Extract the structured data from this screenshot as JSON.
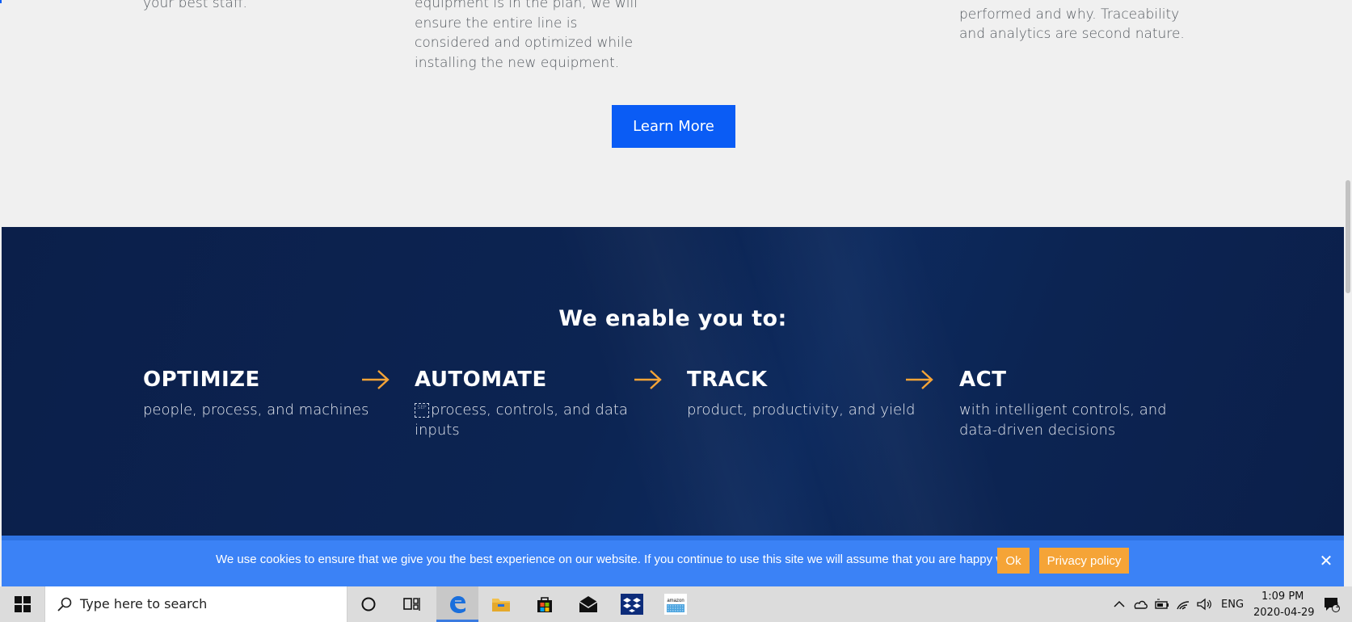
{
  "light": {
    "col1_tail": "your best staff.",
    "col2_lines": [
      "equipment is in the plan, we will",
      "ensure the entire line is",
      "considered and optimized while",
      "installing the new equipment."
    ],
    "col4_lines": [
      "performed and why. Traceability",
      "and analytics are second nature."
    ],
    "learn_more_label": "Learn More"
  },
  "enable": {
    "title": "We enable you to:",
    "pillars": [
      {
        "head": "OPTIMIZE",
        "desc": "people, process, and machines"
      },
      {
        "head": "AUTOMATE",
        "sep": "SEP",
        "desc": "process, controls, and data inputs"
      },
      {
        "head": "TRACK",
        "desc": "product, productivity, and yield"
      },
      {
        "head": "ACT",
        "desc": "with intelligent controls, and data-driven decisions"
      }
    ],
    "arrow_color": "#f5a437"
  },
  "cookie": {
    "message": "We use cookies to ensure that we give you the best experience on our website. If you continue to use this site we will assume that you are happy with it.",
    "ok_label": "Ok",
    "privacy_label": "Privacy policy",
    "close_symbol": "✕"
  },
  "taskbar": {
    "search_placeholder": "Type here to search",
    "lang": "ENG",
    "time": "1:09 PM",
    "date": "2020-04-29",
    "notification_count": "1",
    "amazon_label": "amazon"
  },
  "colors": {
    "brand_blue": "#0a5cf5",
    "navy": "#0c2452",
    "cookie_bg": "#3b82f6",
    "accent_orange": "#f5a437"
  }
}
